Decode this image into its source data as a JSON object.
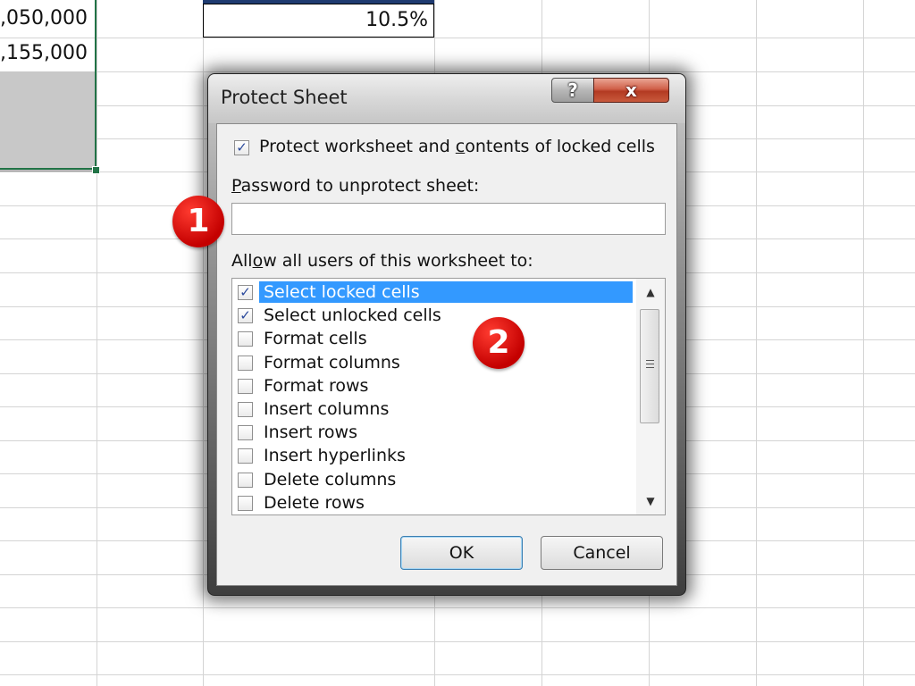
{
  "sheet": {
    "cells": [
      ",050,000",
      ",155,000"
    ],
    "percent_cell": "10.5%"
  },
  "dialog": {
    "title": "Protect Sheet",
    "help_glyph": "?",
    "close_glyph": "x",
    "protect_checkbox": {
      "checked": true,
      "label_pre": "Protect worksheet and ",
      "label_u": "c",
      "label_post": "ontents of locked cells"
    },
    "password": {
      "label_u": "P",
      "label_rest": "assword to unprotect sheet:",
      "value": ""
    },
    "allow": {
      "label_pre": "All",
      "label_u": "o",
      "label_post": "w all users of this worksheet to:"
    },
    "items": [
      {
        "label": "Select locked cells",
        "checked": true,
        "selected": true
      },
      {
        "label": "Select unlocked cells",
        "checked": true,
        "selected": false
      },
      {
        "label": "Format cells",
        "checked": false,
        "selected": false
      },
      {
        "label": "Format columns",
        "checked": false,
        "selected": false
      },
      {
        "label": "Format rows",
        "checked": false,
        "selected": false
      },
      {
        "label": "Insert columns",
        "checked": false,
        "selected": false
      },
      {
        "label": "Insert rows",
        "checked": false,
        "selected": false
      },
      {
        "label": "Insert hyperlinks",
        "checked": false,
        "selected": false
      },
      {
        "label": "Delete columns",
        "checked": false,
        "selected": false
      },
      {
        "label": "Delete rows",
        "checked": false,
        "selected": false
      }
    ],
    "ok_label": "OK",
    "cancel_label": "Cancel"
  },
  "callouts": {
    "one": "1",
    "two": "2"
  },
  "colors": {
    "selection": "#3399ff",
    "callout": "#d40000",
    "sheet_selection_border": "#217346"
  }
}
